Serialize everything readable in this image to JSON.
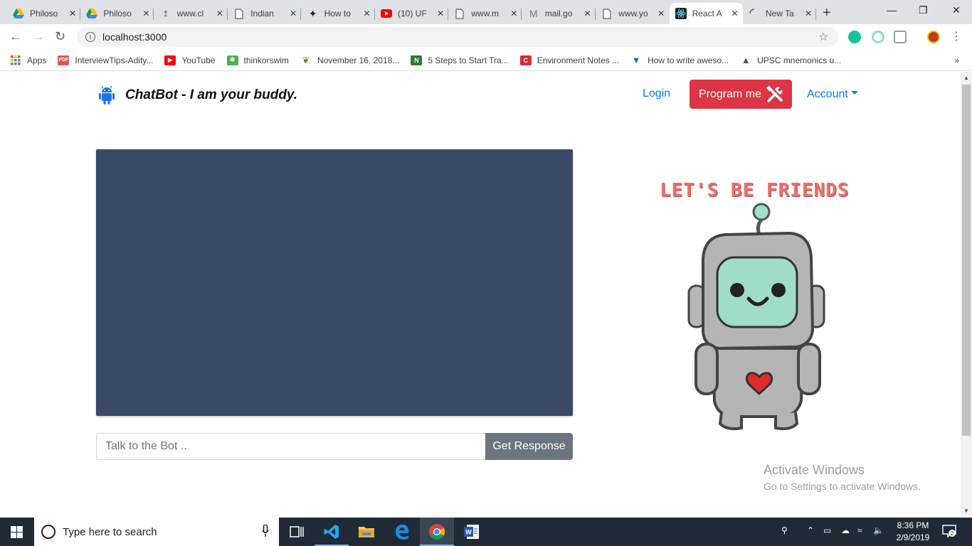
{
  "browser": {
    "tabs": [
      {
        "title": "Philoso",
        "icon": "drive-icon"
      },
      {
        "title": "Philoso",
        "icon": "drive-icon"
      },
      {
        "title": "www.cl",
        "icon": "upload-icon"
      },
      {
        "title": "Indian",
        "icon": "doc-icon"
      },
      {
        "title": "How to",
        "icon": "star-icon"
      },
      {
        "title": "(10) UF",
        "icon": "youtube-icon"
      },
      {
        "title": "www.m",
        "icon": "doc-icon"
      },
      {
        "title": "mail.go",
        "icon": "gmail-icon"
      },
      {
        "title": "www.yo",
        "icon": "doc-icon"
      },
      {
        "title": "React A",
        "icon": "react-icon",
        "active": true
      },
      {
        "title": "New Ta",
        "icon": "loading-icon"
      }
    ],
    "new_tab": "+",
    "window": {
      "minimize": "—",
      "restore": "❐",
      "close": "✕"
    },
    "url": "localhost:3000",
    "bookmarks": [
      {
        "label": "Apps",
        "icon": "apps-icon",
        "color": "#ea4335"
      },
      {
        "label": "InterviewTips-Adity...",
        "icon": "pdf-icon",
        "color": "#e2574c"
      },
      {
        "label": "YouTube",
        "icon": "youtube-icon",
        "color": "#ff0000"
      },
      {
        "label": "thinkorswim",
        "icon": "thinkorswim-icon",
        "color": "#4caf50"
      },
      {
        "label": "November 16, 2018...",
        "icon": "leaf-icon",
        "color": "#5a8f29"
      },
      {
        "label": "5 Steps to Start Tra...",
        "icon": "n-icon",
        "color": "#2e7d32"
      },
      {
        "label": "Environment Notes ...",
        "icon": "c-icon",
        "color": "#d32f2f"
      },
      {
        "label": "How to write aweso...",
        "icon": "bookmark-icon",
        "color": "#1565c0"
      },
      {
        "label": "UPSC mnemonics u...",
        "icon": "upsc-icon",
        "color": "#6d4c41"
      }
    ],
    "bookmarks_more": "»"
  },
  "app": {
    "brand": "ChatBot - I am your buddy.",
    "nav": {
      "login": "Login",
      "program": "Program me",
      "account": "Account"
    },
    "chat": {
      "placeholder": "Talk to the Bot ..",
      "submit": "Get Response"
    },
    "illustration_caption": "LET'S BE FRIENDS"
  },
  "os": {
    "watermark": {
      "title": "Activate Windows",
      "subtitle": "Go to Settings to activate Windows."
    },
    "search_placeholder": "Type here to search",
    "clock": {
      "time": "8:36 PM",
      "date": "2/9/2019"
    },
    "notifications": "2"
  },
  "colors": {
    "primary": "#007bff",
    "danger": "#dc3545",
    "secondary": "#6c757d",
    "chat_panel": "#3a4a66"
  }
}
